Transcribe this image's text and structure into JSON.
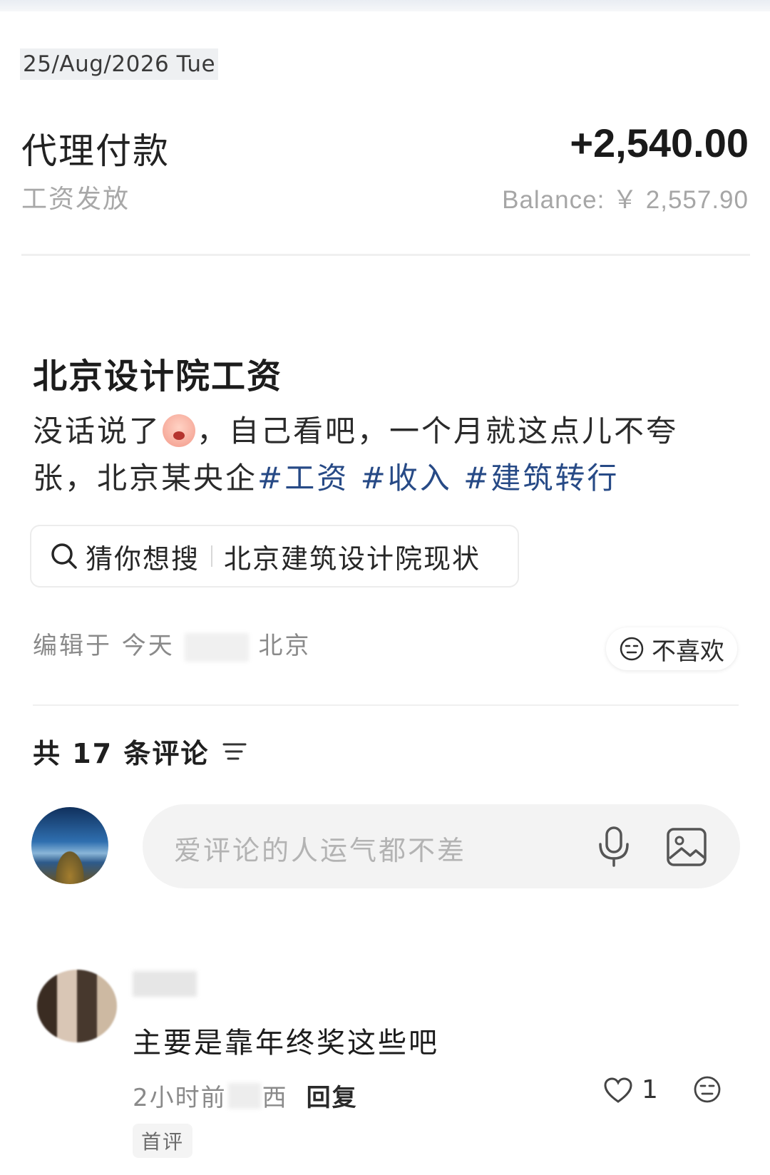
{
  "transaction": {
    "date": "25/Aug/2026 Tue",
    "title": "代理付款",
    "subtitle": "工资发放",
    "amount": "+2,540.00",
    "balance": "Balance: ￥ 2,557.90"
  },
  "post": {
    "title": "北京设计院工资",
    "body_part1": "没话说了",
    "body_part2": "，自己看吧，一个月就这点儿不夸张，北京某央企",
    "tags": [
      "#工资",
      "#收入",
      "#建筑转行"
    ],
    "search_chip": {
      "prefix": "猜你想搜",
      "query": "北京建筑设计院现状"
    },
    "meta": {
      "edited": "编辑于 今天",
      "location": "北京"
    },
    "dislike_label": "不喜欢"
  },
  "comments": {
    "count_label": "共 17 条评论",
    "input_placeholder": "爱评论的人运气都不差",
    "items": [
      {
        "text": "主要是靠年终奖这些吧",
        "time": "2小时前",
        "location": "西",
        "reply_label": "回复",
        "likes": "1",
        "badge": "首评"
      }
    ]
  },
  "icons": {
    "search": "search-icon",
    "dislike": "neutral-face-icon",
    "sort": "sort-lines-icon",
    "mic": "microphone-icon",
    "image": "image-icon",
    "like": "heart-icon",
    "react": "emoji-icon"
  },
  "colors": {
    "tag": "#274a86",
    "muted": "#a8a8a8"
  }
}
